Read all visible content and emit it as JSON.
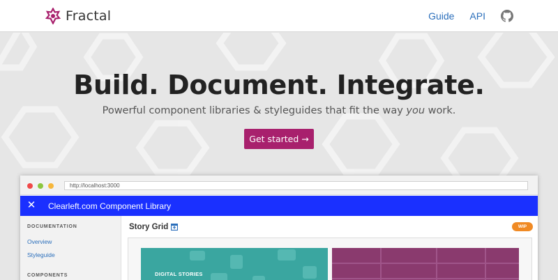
{
  "brand": {
    "name": "Fractal",
    "color": "#a8206d"
  },
  "nav": {
    "guide": "Guide",
    "api": "API",
    "github_icon": "github-icon"
  },
  "hero": {
    "title": "Build. Document. Integrate.",
    "subtitle_pre": "Powerful component libraries & styleguides that fit the way ",
    "subtitle_em": "you",
    "subtitle_post": " work.",
    "cta": "Get started →"
  },
  "browser": {
    "url": "http://localhost:3000",
    "app_title": "Clearleft.com Component Library",
    "accent": "#1a30ff",
    "sidebar": {
      "documentation_heading": "DOCUMENTATION",
      "links": [
        "Overview",
        "Styleguide"
      ],
      "components_heading": "COMPONENTS"
    },
    "main": {
      "title": "Story Grid",
      "badge": "WIP",
      "card1_label": "DIGITAL STORIES"
    }
  }
}
